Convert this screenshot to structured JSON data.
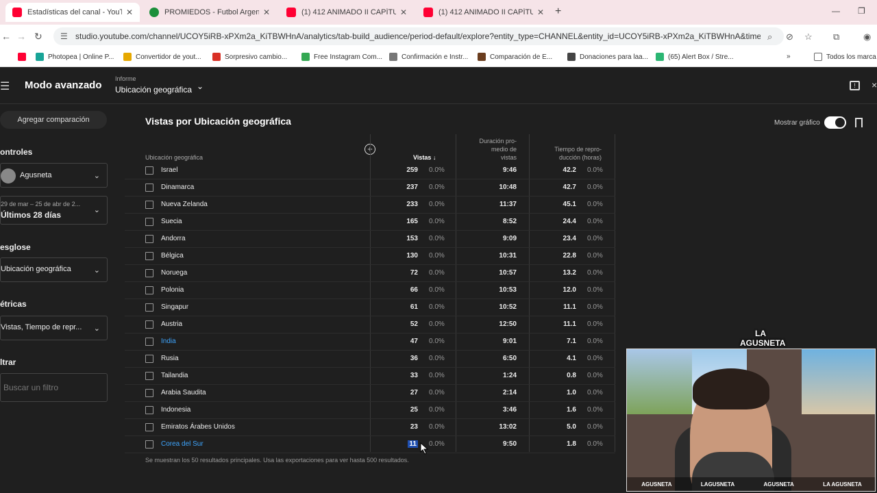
{
  "browser": {
    "tabs": [
      {
        "title": "Estadísticas del canal - YouTube",
        "active": true,
        "icon": "youtube-icon"
      },
      {
        "title": "PROMIEDOS - Futbol Argentino",
        "active": false,
        "icon": "ball-icon"
      },
      {
        "title": "(1) 412 ANIMADO II CAPÍTULO",
        "active": false,
        "icon": "youtube-icon"
      },
      {
        "title": "(1) 412 ANIMADO II CAPÍTULO",
        "active": false,
        "icon": "youtube-icon"
      }
    ],
    "url": "studio.youtube.com/channel/UCOY5iRB-xPXm2a_KiTBWHnA/analytics/tab-build_audience/period-default/explore?entity_type=CHANNEL&entity_id=UCOY5iRB-xPXm2a_KiTBWHnA&time_perio...",
    "bookmarks": [
      {
        "label": "",
        "color": "#ff0033"
      },
      {
        "label": "Photopea | Online P...",
        "color": "#18a497"
      },
      {
        "label": "Convertidor de yout...",
        "color": "#e6a800"
      },
      {
        "label": "Sorpresivo cambio...",
        "color": "#d93025"
      },
      {
        "label": "Free Instagram Com...",
        "color": "#34a853"
      },
      {
        "label": "Confirmación e Instr...",
        "color": "#777777"
      },
      {
        "label": "Comparación de E...",
        "color": "#6b3d1e"
      },
      {
        "label": "Donaciones para laa...",
        "color": "#444444"
      },
      {
        "label": "(65) Alert Box / Stre...",
        "color": "#2bb673"
      }
    ],
    "all_bookmarks": "Todos los marca"
  },
  "studio": {
    "mode_title": "Modo avanzado",
    "report_label": "Informe",
    "report_value": "Ubicación geográfica",
    "compare_button": "Agregar comparación",
    "sections": {
      "controls": "ontroles",
      "channel": "Agusneta",
      "date_range": "29 de mar – 25 de abr de 2...",
      "date_preset": "Últimos 28 días",
      "breakdown": "esglose",
      "breakdown_value": "Ubicación geográfica",
      "metrics": "étricas",
      "metrics_value": "Vistas, Tiempo de repr...",
      "filter": "ltrar",
      "filter_placeholder": "Buscar un filtro"
    },
    "table_title": "Vistas por Ubicación geográfica",
    "show_chart": "Mostrar gráfico",
    "columns": {
      "location": "Ubicación geográfica",
      "views": "Vistas",
      "avg_duration": [
        "Duración pro-",
        "medio de",
        "vistas"
      ],
      "watch_time": [
        "Tiempo de repro-",
        "ducción (horas)"
      ]
    },
    "rows": [
      {
        "country": "Israel",
        "views": "259",
        "views_pct": "0.0%",
        "duration": "9:46",
        "hours": "42.2",
        "hours_pct": "0.0%"
      },
      {
        "country": "Dinamarca",
        "views": "237",
        "views_pct": "0.0%",
        "duration": "10:48",
        "hours": "42.7",
        "hours_pct": "0.0%"
      },
      {
        "country": "Nueva Zelanda",
        "views": "233",
        "views_pct": "0.0%",
        "duration": "11:37",
        "hours": "45.1",
        "hours_pct": "0.0%"
      },
      {
        "country": "Suecia",
        "views": "165",
        "views_pct": "0.0%",
        "duration": "8:52",
        "hours": "24.4",
        "hours_pct": "0.0%"
      },
      {
        "country": "Andorra",
        "views": "153",
        "views_pct": "0.0%",
        "duration": "9:09",
        "hours": "23.4",
        "hours_pct": "0.0%"
      },
      {
        "country": "Bélgica",
        "views": "130",
        "views_pct": "0.0%",
        "duration": "10:31",
        "hours": "22.8",
        "hours_pct": "0.0%"
      },
      {
        "country": "Noruega",
        "views": "72",
        "views_pct": "0.0%",
        "duration": "10:57",
        "hours": "13.2",
        "hours_pct": "0.0%"
      },
      {
        "country": "Polonia",
        "views": "66",
        "views_pct": "0.0%",
        "duration": "10:53",
        "hours": "12.0",
        "hours_pct": "0.0%"
      },
      {
        "country": "Singapur",
        "views": "61",
        "views_pct": "0.0%",
        "duration": "10:52",
        "hours": "11.1",
        "hours_pct": "0.0%"
      },
      {
        "country": "Austria",
        "views": "52",
        "views_pct": "0.0%",
        "duration": "12:50",
        "hours": "11.1",
        "hours_pct": "0.0%"
      },
      {
        "country": "India",
        "views": "47",
        "views_pct": "0.0%",
        "duration": "9:01",
        "hours": "7.1",
        "hours_pct": "0.0%",
        "link": true
      },
      {
        "country": "Rusia",
        "views": "36",
        "views_pct": "0.0%",
        "duration": "6:50",
        "hours": "4.1",
        "hours_pct": "0.0%"
      },
      {
        "country": "Tailandia",
        "views": "33",
        "views_pct": "0.0%",
        "duration": "1:24",
        "hours": "0.8",
        "hours_pct": "0.0%"
      },
      {
        "country": "Arabia Saudita",
        "views": "27",
        "views_pct": "0.0%",
        "duration": "2:14",
        "hours": "1.0",
        "hours_pct": "0.0%"
      },
      {
        "country": "Indonesia",
        "views": "25",
        "views_pct": "0.0%",
        "duration": "3:46",
        "hours": "1.6",
        "hours_pct": "0.0%"
      },
      {
        "country": "Emiratos Árabes Unidos",
        "views": "23",
        "views_pct": "0.0%",
        "duration": "13:02",
        "hours": "5.0",
        "hours_pct": "0.0%"
      },
      {
        "country": "Corea del Sur",
        "views": "11",
        "views_pct": "0.0%",
        "duration": "9:50",
        "hours": "1.8",
        "hours_pct": "0.0%",
        "link": true,
        "selected": true
      }
    ],
    "footnote": "Se muestran los 50 resultados principales. Usa las exportaciones para ver hasta 500 resultados."
  },
  "webcam": {
    "logo": [
      "LA",
      "AGUSNETA"
    ],
    "social": [
      "AGUSNETA",
      "LAGUSNETA",
      "AGUSNETA",
      "LA AGUSNETA"
    ]
  },
  "colors": {
    "accent": "#3ea6ff",
    "youtube_red": "#ff0033",
    "background": "#1f1f1f"
  }
}
